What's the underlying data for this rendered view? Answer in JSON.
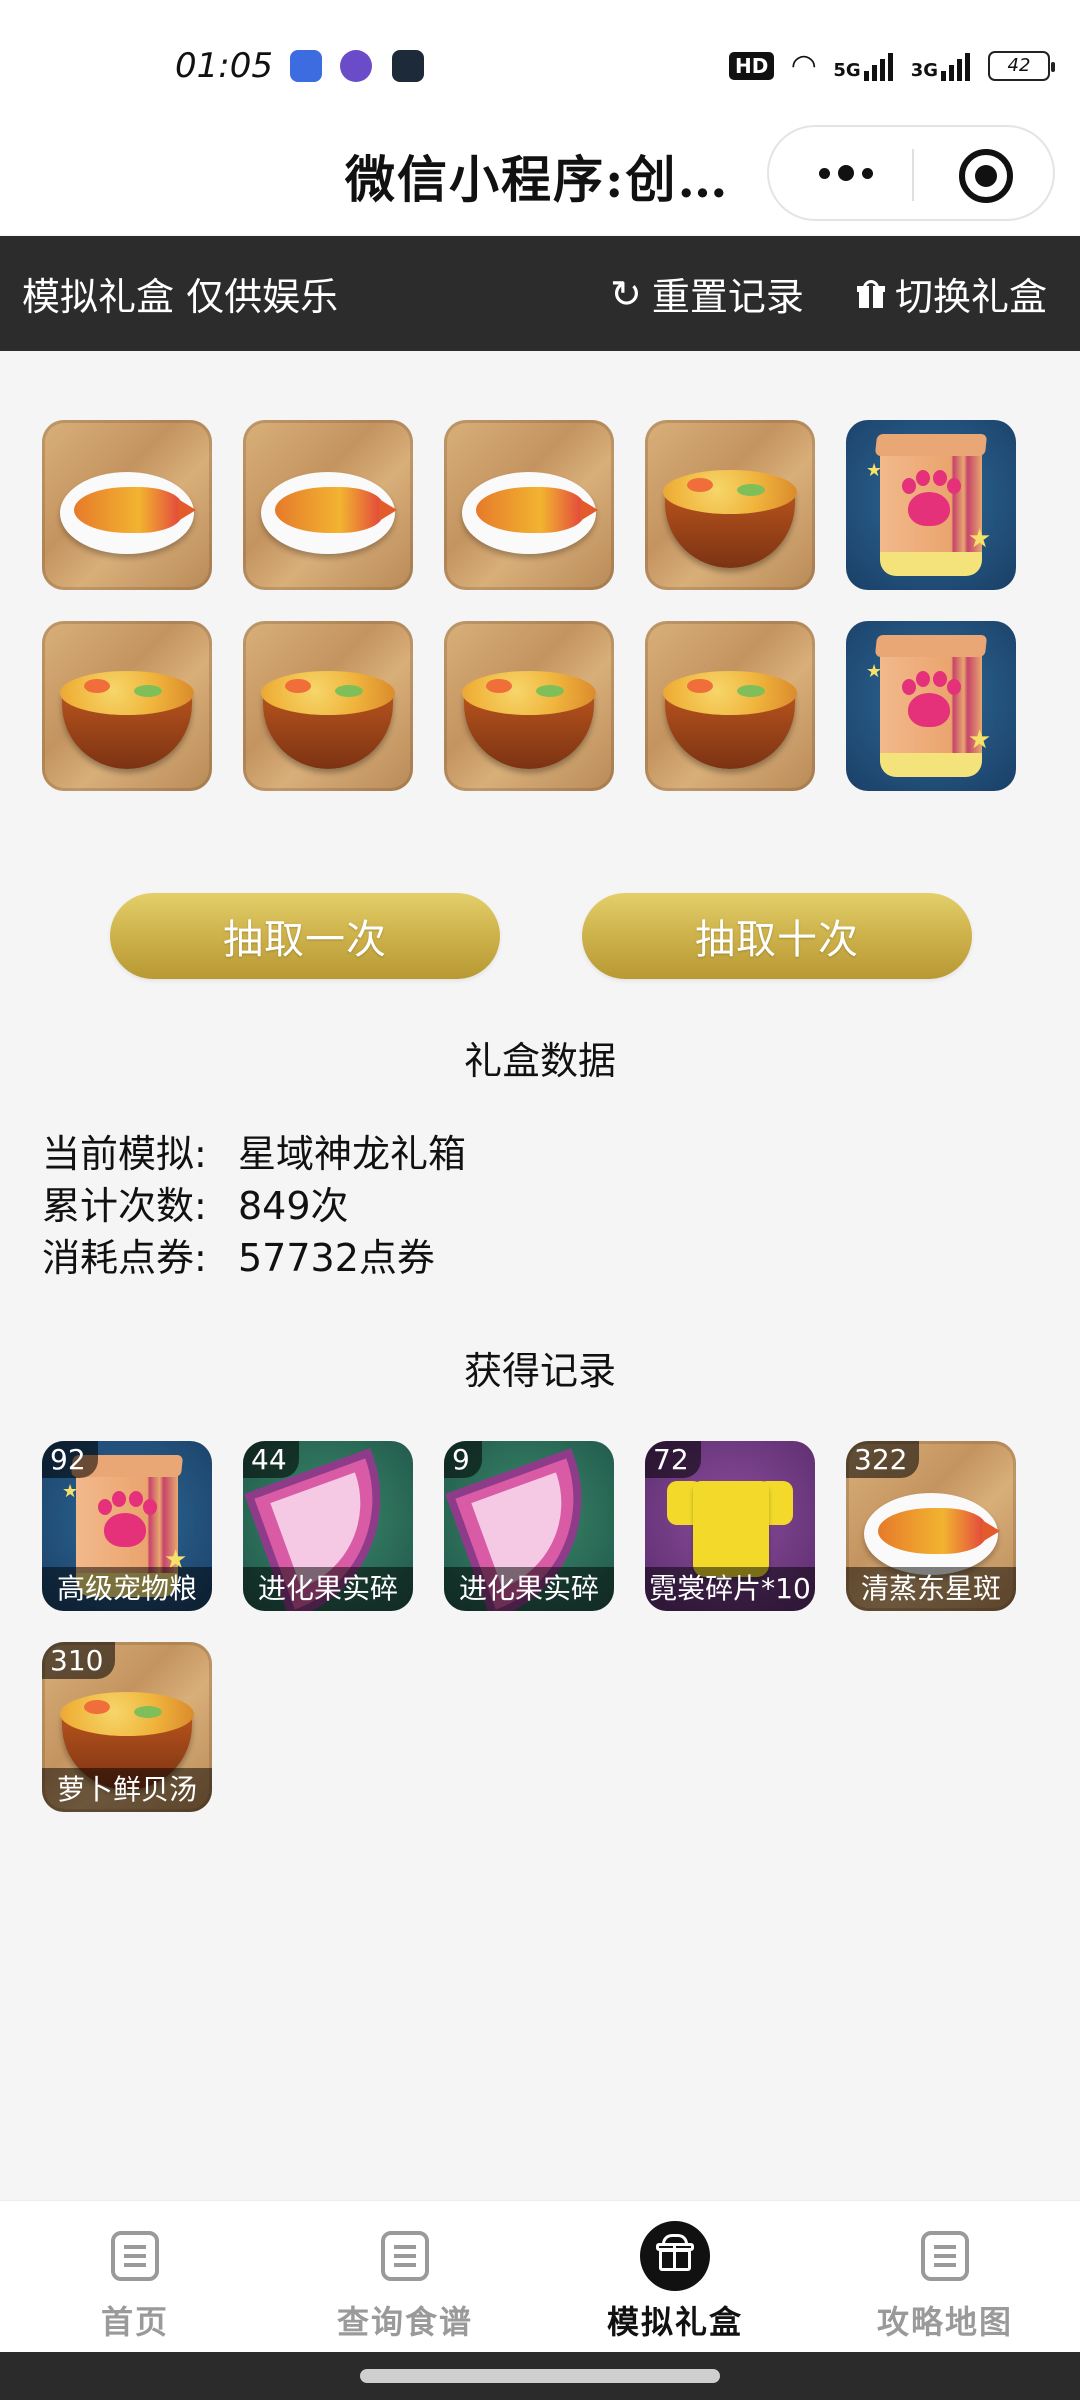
{
  "status_bar": {
    "time": "01:05",
    "hd_label": "HD",
    "net1": "5G",
    "net2": "3G",
    "battery": "42"
  },
  "mini_program": {
    "title": "微信小程序:创…",
    "more_icon": "more-dots-icon",
    "close_icon": "target-close-icon"
  },
  "header": {
    "title": "模拟礼盒 仅供娱乐",
    "reset_label": "重置记录",
    "switch_label": "切换礼盒"
  },
  "draw_results": [
    {
      "item": "fish-dish"
    },
    {
      "item": "fish-dish"
    },
    {
      "item": "fish-dish"
    },
    {
      "item": "soup-bowl"
    },
    {
      "item": "pet-food-bag"
    },
    {
      "item": "soup-bowl"
    },
    {
      "item": "soup-bowl"
    },
    {
      "item": "soup-bowl"
    },
    {
      "item": "soup-bowl"
    },
    {
      "item": "pet-food-bag"
    }
  ],
  "buttons": {
    "draw_one": "抽取一次",
    "draw_ten": "抽取十次"
  },
  "box_data": {
    "title": "礼盒数据",
    "current_label": "当前模拟:",
    "current_value": "星域神龙礼箱",
    "count_label": "累计次数:",
    "count_value": "849次",
    "cost_label": "消耗点券:",
    "cost_value": "57732点券"
  },
  "records": {
    "title": "获得记录",
    "items": [
      {
        "count": "92",
        "label": "高级宠物粮",
        "item": "pet-food-bag"
      },
      {
        "count": "44",
        "label": "进化果实碎",
        "item": "fruit-fragment"
      },
      {
        "count": "9",
        "label": "进化果实碎",
        "item": "fruit-fragment"
      },
      {
        "count": "72",
        "label": "霓裳碎片*10",
        "item": "shirt"
      },
      {
        "count": "322",
        "label": "清蒸东星斑",
        "item": "fish-dish"
      },
      {
        "count": "310",
        "label": "萝卜鲜贝汤",
        "item": "soup-bowl"
      }
    ]
  },
  "tabs": [
    {
      "label": "首页",
      "active": false
    },
    {
      "label": "查询食谱",
      "active": false
    },
    {
      "label": "模拟礼盒",
      "active": true
    },
    {
      "label": "攻略地图",
      "active": false
    }
  ],
  "colors": {
    "header_bg": "#2c2c2c",
    "button_gold": "#cdb14a",
    "page_bg": "#f5f5f5"
  }
}
